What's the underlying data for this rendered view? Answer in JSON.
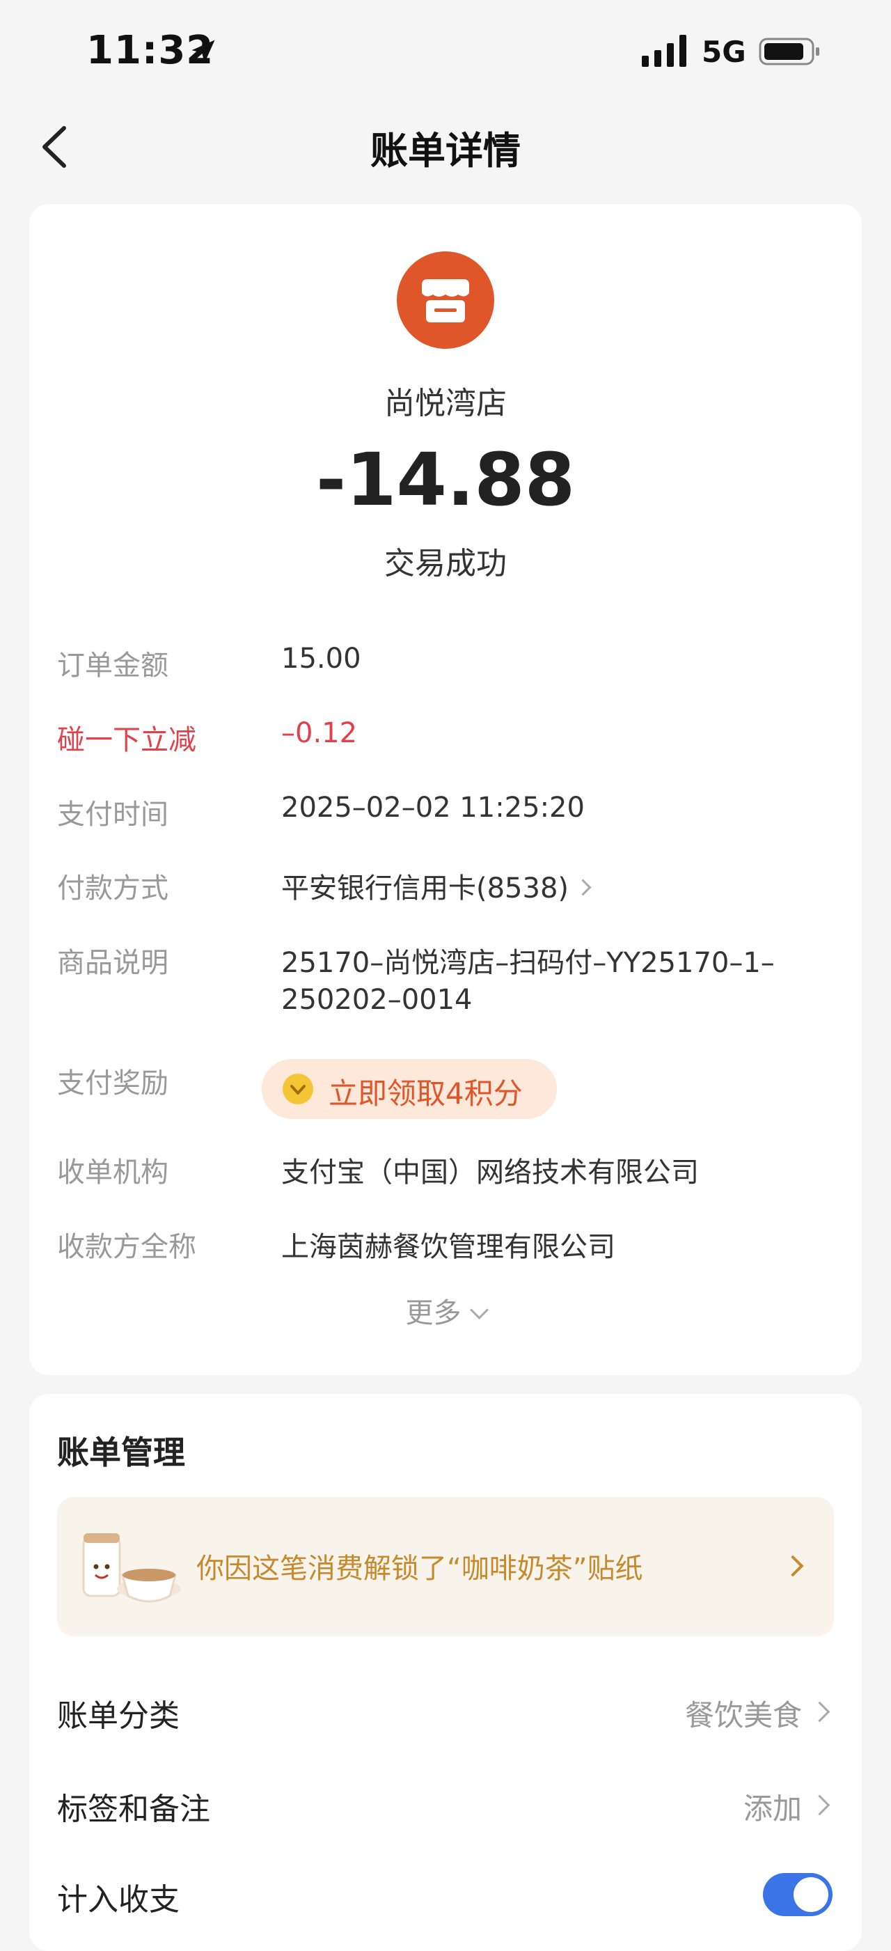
{
  "status_bar": {
    "time": "11:32",
    "network": "5G"
  },
  "nav": {
    "title": "账单详情"
  },
  "bill": {
    "merchant": "尚悦湾店",
    "amount": "-14.88",
    "status": "交易成功",
    "rows": {
      "order_amount": {
        "label": "订单金额",
        "value": "15.00"
      },
      "discount": {
        "label": "碰一下立减",
        "value": "–0.12"
      },
      "pay_time": {
        "label": "支付时间",
        "value": "2025–02–02 11:25:20"
      },
      "pay_method": {
        "label": "付款方式",
        "value": "平安银行信用卡(8538)"
      },
      "description": {
        "label": "商品说明",
        "value_line1": "25170–尚悦湾店–扫码付–YY25170–1–",
        "value_line2": "250202–0014"
      },
      "reward": {
        "label": "支付奖励",
        "value": "立即领取4积分"
      },
      "acquirer": {
        "label": "收单机构",
        "value": "支付宝（中国）网络技术有限公司"
      },
      "payee": {
        "label": "收款方全称",
        "value": "上海茵赫餐饮管理有限公司"
      }
    },
    "more_label": "更多"
  },
  "management": {
    "title": "账单管理",
    "sticker_text": "你因这笔消费解锁了“咖啡奶茶”贴纸",
    "category": {
      "label": "账单分类",
      "value": "餐饮美食"
    },
    "tags": {
      "label": "标签和备注",
      "value": "添加"
    },
    "include": {
      "label": "计入收支",
      "enabled": true
    }
  },
  "colors": {
    "accent": "#e0562b",
    "discount_red": "#e0414a",
    "toggle_blue": "#3a74e6",
    "sticker_gold": "#c58a2e"
  }
}
